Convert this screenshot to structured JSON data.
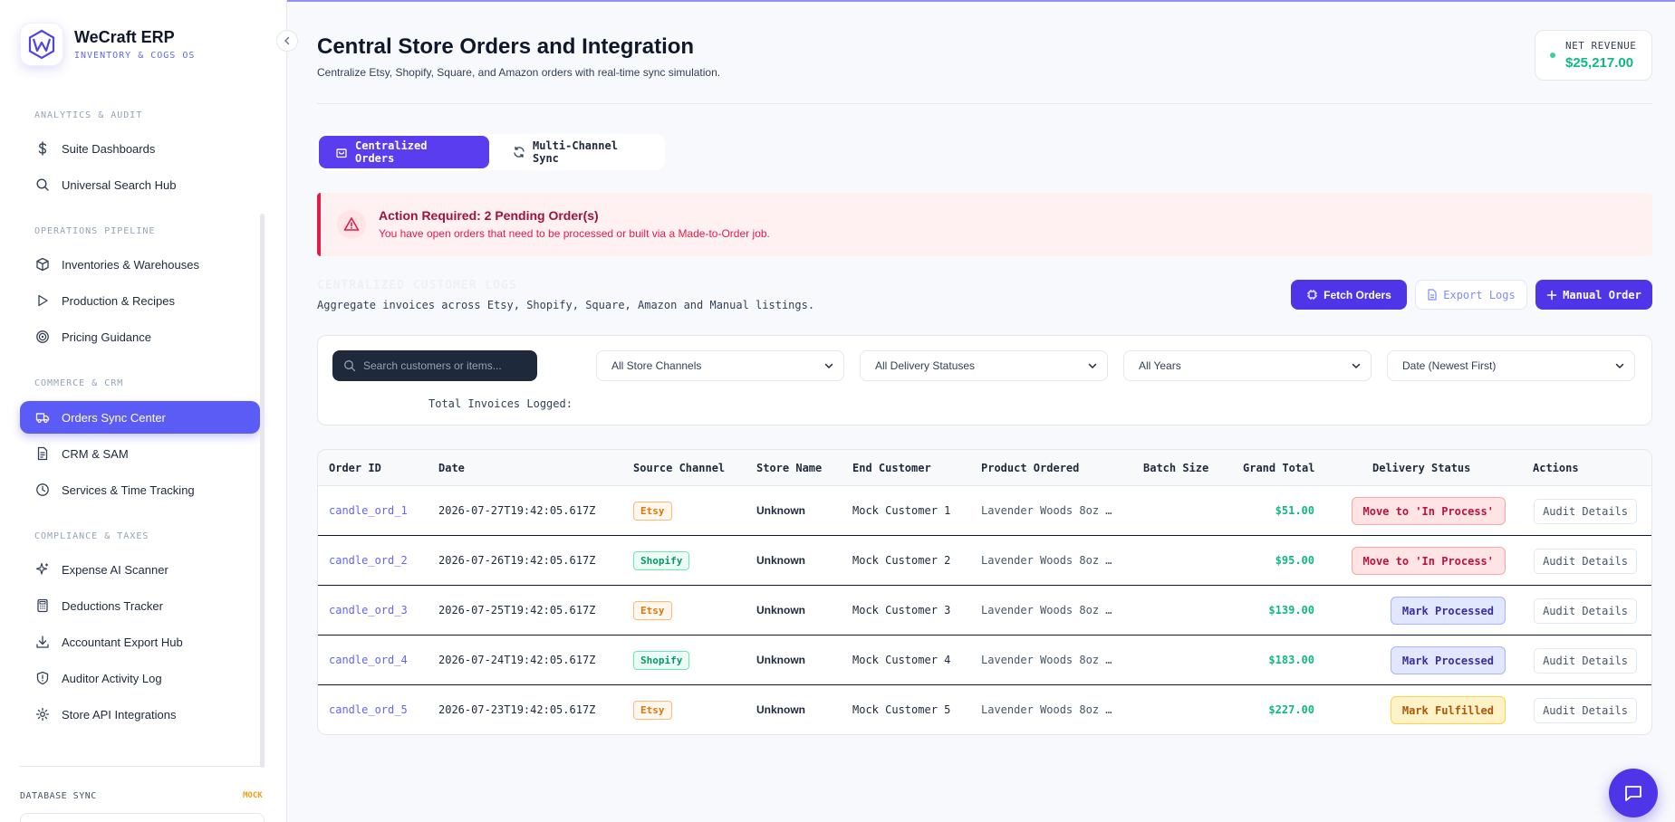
{
  "brand": {
    "name": "WeCraft ERP",
    "subtitle": "INVENTORY & COGS OS"
  },
  "sidebar": {
    "sections": [
      {
        "label": "ANALYTICS & AUDIT",
        "items": [
          {
            "label": "Suite Dashboards",
            "icon": "dollar-icon"
          },
          {
            "label": "Universal Search Hub",
            "icon": "search-icon"
          }
        ]
      },
      {
        "label": "OPERATIONS PIPELINE",
        "items": [
          {
            "label": "Inventories & Warehouses",
            "icon": "box-icon"
          },
          {
            "label": "Production & Recipes",
            "icon": "play-icon"
          },
          {
            "label": "Pricing Guidance",
            "icon": "target-icon"
          }
        ]
      },
      {
        "label": "COMMERCE & CRM",
        "items": [
          {
            "label": "Orders Sync Center",
            "icon": "truck-icon",
            "active": true
          },
          {
            "label": "CRM & SAM",
            "icon": "document-icon"
          },
          {
            "label": "Services & Time Tracking",
            "icon": "clock-icon"
          }
        ]
      },
      {
        "label": "COMPLIANCE & TAXES",
        "items": [
          {
            "label": "Expense AI Scanner",
            "icon": "sparkle-icon"
          },
          {
            "label": "Deductions Tracker",
            "icon": "calculator-icon"
          },
          {
            "label": "Accountant Export Hub",
            "icon": "download-icon"
          },
          {
            "label": "Auditor Activity Log",
            "icon": "shield-icon"
          },
          {
            "label": "Store API Integrations",
            "icon": "gear-icon"
          }
        ]
      }
    ],
    "db_sync": {
      "label": "DATABASE SYNC",
      "badge": "MOCK"
    }
  },
  "header": {
    "title": "Central Store Orders and Integration",
    "subtitle": "Centralize Etsy, Shopify, Square, and Amazon orders with real-time sync simulation.",
    "revenue_label": "NET REVENUE",
    "revenue_value": "$25,217.00"
  },
  "tabs": [
    {
      "label": "Centralized Orders",
      "icon": "bag-icon",
      "active": true
    },
    {
      "label": "Multi-Channel Sync",
      "icon": "refresh-icon",
      "active": false
    }
  ],
  "alert": {
    "title": "Action Required: 2 Pending Order(s)",
    "text": "You have open orders that need to be processed or built via a Made-to-Order job."
  },
  "ledger": {
    "heading": "CENTRALIZED CUSTOMER LOGS",
    "subtitle": "Aggregate invoices across Etsy, Shopify, Square, Amazon and Manual listings.",
    "fetch_label": "Fetch Orders",
    "export_label": "Export Logs",
    "manual_label": "Manual Order"
  },
  "filters": {
    "search_placeholder": "Search customers or items...",
    "channel": "All Store Channels",
    "delivery": "All Delivery Statuses",
    "years": "All Years",
    "sort": "Date (Newest First)",
    "total_label": "Total Invoices Logged:"
  },
  "table": {
    "columns": [
      "Order ID",
      "Date",
      "Source Channel",
      "Store Name",
      "End Customer",
      "Product Ordered",
      "Batch Size",
      "Grand Total",
      "Delivery Status",
      "Actions"
    ],
    "rows": [
      {
        "id": "candle_ord_1",
        "date": "2026-07-27T19:42:05.617Z",
        "channel": "Etsy",
        "store": "Unknown",
        "customer": "Mock Customer 1",
        "product": "Lavender Woods 8oz …",
        "batch": "",
        "total": "$51.00",
        "status": "Move to 'In Process'",
        "status_kind": "red",
        "action": "Audit Details"
      },
      {
        "id": "candle_ord_2",
        "date": "2026-07-26T19:42:05.617Z",
        "channel": "Shopify",
        "store": "Unknown",
        "customer": "Mock Customer 2",
        "product": "Lavender Woods 8oz …",
        "batch": "",
        "total": "$95.00",
        "status": "Move to 'In Process'",
        "status_kind": "red",
        "action": "Audit Details"
      },
      {
        "id": "candle_ord_3",
        "date": "2026-07-25T19:42:05.617Z",
        "channel": "Etsy",
        "store": "Unknown",
        "customer": "Mock Customer 3",
        "product": "Lavender Woods 8oz …",
        "batch": "",
        "total": "$139.00",
        "status": "Mark Processed",
        "status_kind": "purple",
        "action": "Audit Details"
      },
      {
        "id": "candle_ord_4",
        "date": "2026-07-24T19:42:05.617Z",
        "channel": "Shopify",
        "store": "Unknown",
        "customer": "Mock Customer 4",
        "product": "Lavender Woods 8oz …",
        "batch": "",
        "total": "$183.00",
        "status": "Mark Processed",
        "status_kind": "purple",
        "action": "Audit Details"
      },
      {
        "id": "candle_ord_5",
        "date": "2026-07-23T19:42:05.617Z",
        "channel": "Etsy",
        "store": "Unknown",
        "customer": "Mock Customer 5",
        "product": "Lavender Woods 8oz …",
        "batch": "",
        "total": "$227.00",
        "status": "Mark Fulfilled",
        "status_kind": "yellow",
        "action": "Audit Details"
      }
    ]
  },
  "colors": {
    "accent": "#5b3df0",
    "success": "#10b981",
    "danger": "#e11d48"
  }
}
